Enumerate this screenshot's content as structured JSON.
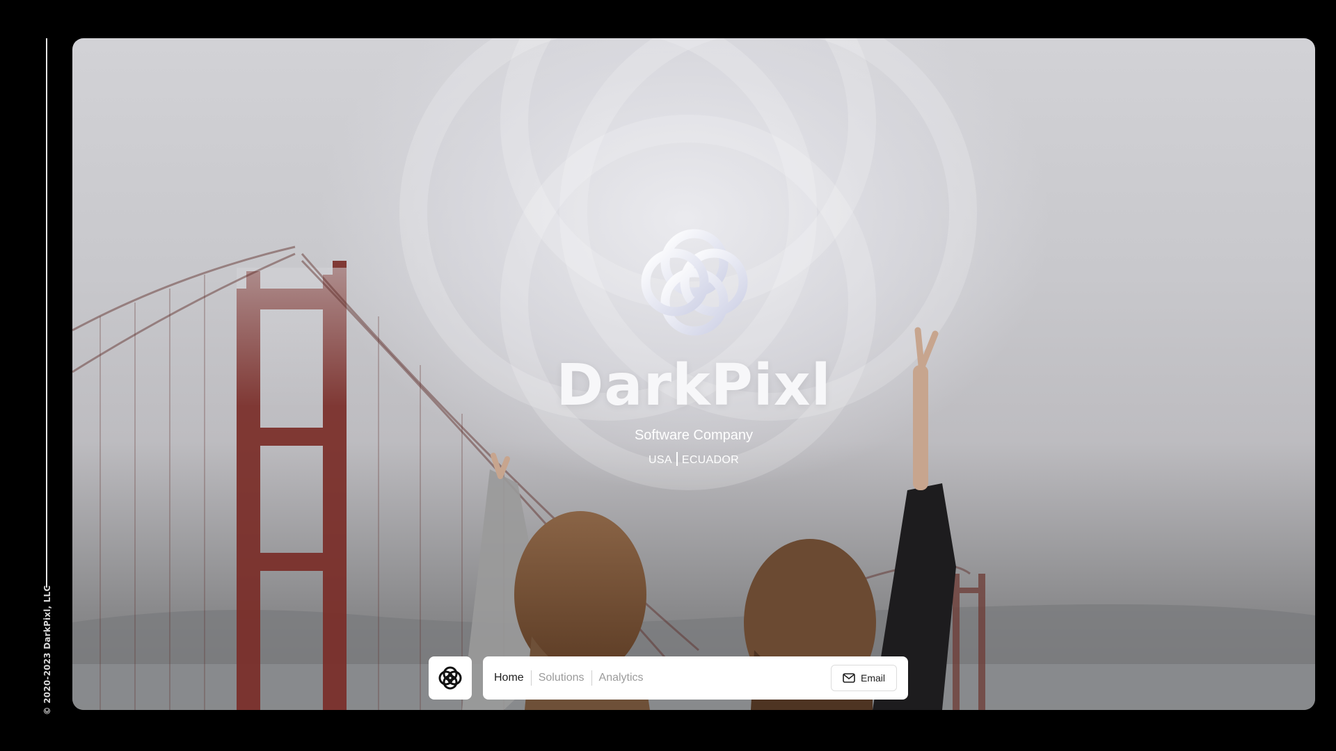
{
  "sidebar": {
    "copyright": "© 2020-2023 DarkPixl, LLC"
  },
  "hero": {
    "brand_name": "DarkPixl",
    "tagline": "Software Company",
    "location_left": "USA",
    "location_right": "ECUADOR",
    "logo_icon": "interlocked-rings-logo-icon"
  },
  "nav": {
    "items": [
      {
        "label": "Home",
        "active": true
      },
      {
        "label": "Solutions",
        "active": false
      },
      {
        "label": "Analytics",
        "active": false
      }
    ],
    "email_label": "Email",
    "email_icon": "envelope-icon",
    "logo_icon": "interlocked-rings-logo-icon"
  },
  "colors": {
    "background": "#000000",
    "nav_bg": "#ffffff",
    "active_text": "#1e1e1e",
    "inactive_text": "#9b9b9b"
  }
}
